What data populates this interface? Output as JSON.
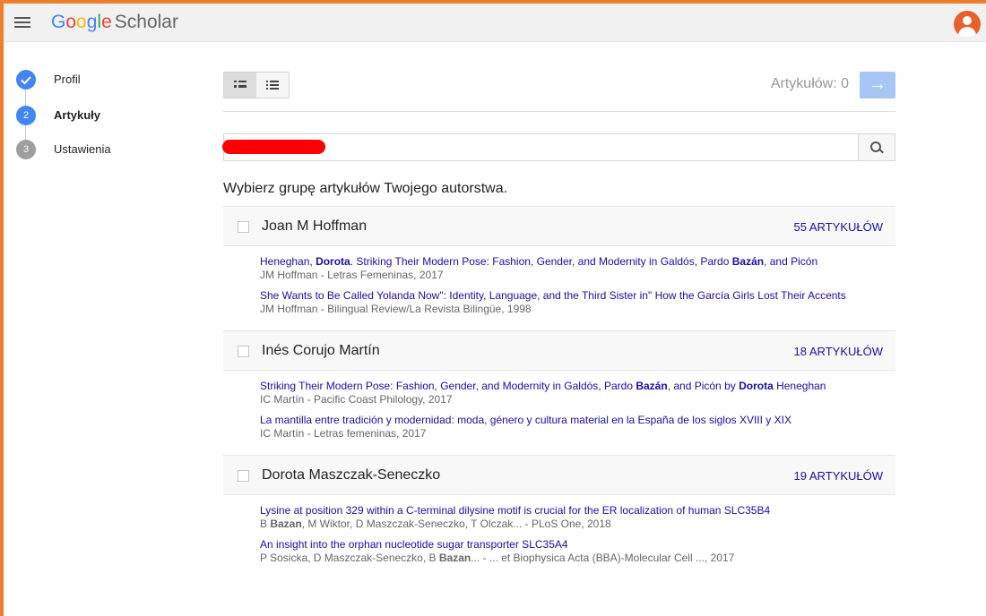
{
  "app": {
    "logo_google": [
      "G",
      "o",
      "o",
      "g",
      "l",
      "e"
    ],
    "logo_scholar": "Scholar"
  },
  "colors": {
    "frame": "#ee7f2d",
    "link": "#1a0dab",
    "step_done": "#4285f4",
    "step_inactive": "#9e9e9e",
    "next": "#a7c6f6"
  },
  "steps": [
    {
      "num": "",
      "label": "Profil",
      "state": "done"
    },
    {
      "num": "2",
      "label": "Artykuły",
      "state": "active"
    },
    {
      "num": "3",
      "label": "Ustawienia",
      "state": "inactive"
    }
  ],
  "toolbar": {
    "counter": "Artykułów: 0",
    "next_icon": "→"
  },
  "search": {
    "value": "",
    "placeholder": ""
  },
  "prompt": "Wybierz grupę artykułów Twojego autorstwa.",
  "groups": [
    {
      "name": "Joan M Hoffman",
      "count": "55 artykułów",
      "articles": [
        {
          "title_html": "Heneghan, <b>Dorota</b>. Striking Their Modern Pose: Fashion, Gender, and Modernity in Galdós, Pardo <b>Bazán</b>, and Picón",
          "meta_html": "JM Hoffman - Letras Femeninas, 2017"
        },
        {
          "title_html": "She Wants to Be Called Yolanda Now\": Identity, Language, and the Third Sister in\" How the García Girls Lost Their Accents",
          "meta_html": "JM Hoffman - Bilingual Review/La Revista Bilingüe, 1998"
        }
      ]
    },
    {
      "name": "Inés Corujo Martín",
      "count": "18 artykułów",
      "articles": [
        {
          "title_html": "Striking Their Modern Pose: Fashion, Gender, and Modernity in Galdós, Pardo <b>Bazán</b>, and Picón by <b>Dorota</b> Heneghan",
          "meta_html": "IC Martín - Pacific Coast Philology, 2017"
        },
        {
          "title_html": "La mantilla entre tradición y modernidad: moda, género y cultura material en la España de los siglos XVIII y XIX",
          "meta_html": "IC Martín - Letras femeninas, 2017"
        }
      ]
    },
    {
      "name": "Dorota Maszczak-Seneczko",
      "count": "19 artykułów",
      "articles": [
        {
          "title_html": "Lysine at position 329 within a C-terminal dilysine motif is crucial for the ER localization of human SLC35B4",
          "meta_html": "B <b>Bazan</b>, M Wiktor, D Maszczak-Seneczko, T Olczak... - PLoS One, 2018"
        },
        {
          "title_html": "An insight into the orphan nucleotide sugar transporter SLC35A4",
          "meta_html": "P Sosicka, D Maszczak-Seneczko, B <b>Bazan</b>... - ... et Biophysica Acta (BBA)-Molecular Cell ..., 2017"
        }
      ]
    }
  ]
}
